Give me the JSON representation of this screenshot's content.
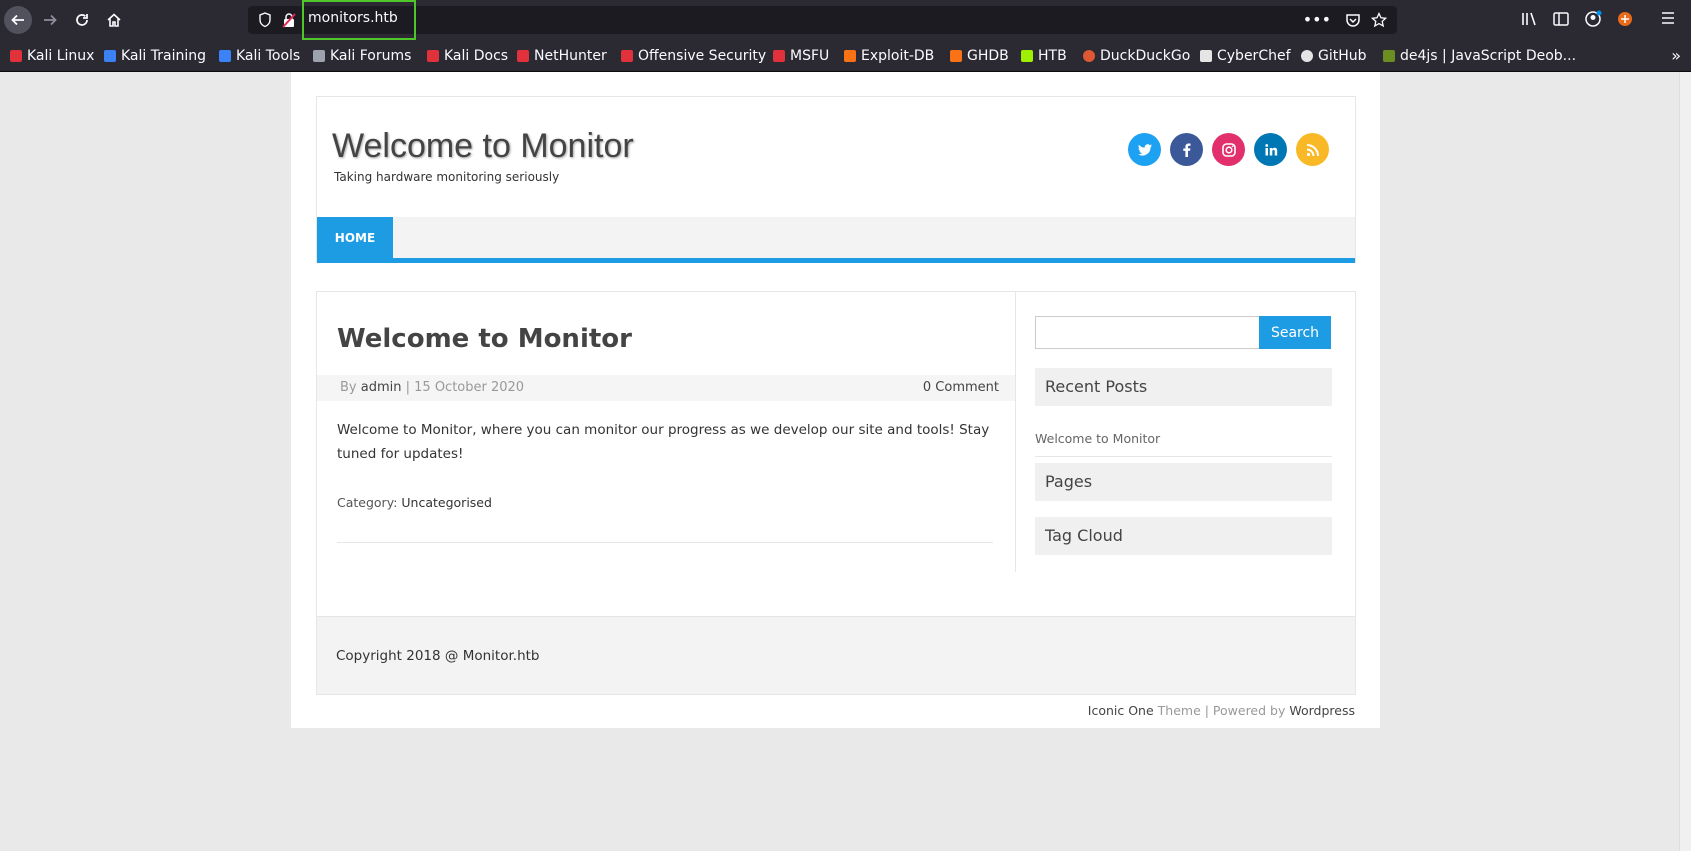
{
  "browser": {
    "url": "monitors.htb",
    "bookmarks": [
      {
        "label": "Kali Linux",
        "color": "#e1313b"
      },
      {
        "label": "Kali Training",
        "color": "#3b82f6"
      },
      {
        "label": "Kali Tools",
        "color": "#3b82f6"
      },
      {
        "label": "Kali Forums",
        "color": "#9ca3af"
      },
      {
        "label": "Kali Docs",
        "color": "#e1313b"
      },
      {
        "label": "NetHunter",
        "color": "#e1313b"
      },
      {
        "label": "Offensive Security",
        "color": "#e1313b"
      },
      {
        "label": "MSFU",
        "color": "#e1313b"
      },
      {
        "label": "Exploit-DB",
        "color": "#f97316"
      },
      {
        "label": "GHDB",
        "color": "#f97316"
      },
      {
        "label": "HTB",
        "color": "#9fef00"
      },
      {
        "label": "DuckDuckGo",
        "color": "#de5833"
      },
      {
        "label": "CyberChef",
        "color": "#e5e5e5"
      },
      {
        "label": "GitHub",
        "color": "#e5e5e5"
      },
      {
        "label": "de4js | JavaScript Deob...",
        "color": "#6b8e23"
      }
    ]
  },
  "site": {
    "title": "Welcome to Monitor",
    "description": "Taking hardware monitoring seriously",
    "nav": {
      "home": "HOME"
    },
    "social": [
      {
        "name": "twitter-icon",
        "color": "#1da1f2"
      },
      {
        "name": "facebook-icon",
        "color": "#3b5998"
      },
      {
        "name": "instagram-icon",
        "color": "#e1306c"
      },
      {
        "name": "linkedin-icon",
        "color": "#0077b5"
      },
      {
        "name": "rss-icon",
        "color": "#f9b825"
      }
    ]
  },
  "post": {
    "title": "Welcome to Monitor",
    "by": "By",
    "author": "admin",
    "date": "| 15 October 2020",
    "comments": "0 Comment",
    "body": "Welcome to Monitor, where you can monitor our progress as we develop our site and tools! Stay tuned for updates!",
    "category_label": "Category:",
    "category": "Uncategorised"
  },
  "sidebar": {
    "search_button": "Search",
    "recent_posts_title": "Recent Posts",
    "recent_posts": [
      "Welcome to Monitor"
    ],
    "pages_title": "Pages",
    "tag_cloud_title": "Tag Cloud"
  },
  "footer": {
    "copyright": "Copyright 2018 @ Monitor.htb",
    "theme_link": "Iconic One",
    "theme_text": " Theme | Powered by ",
    "wp_link": "Wordpress"
  }
}
